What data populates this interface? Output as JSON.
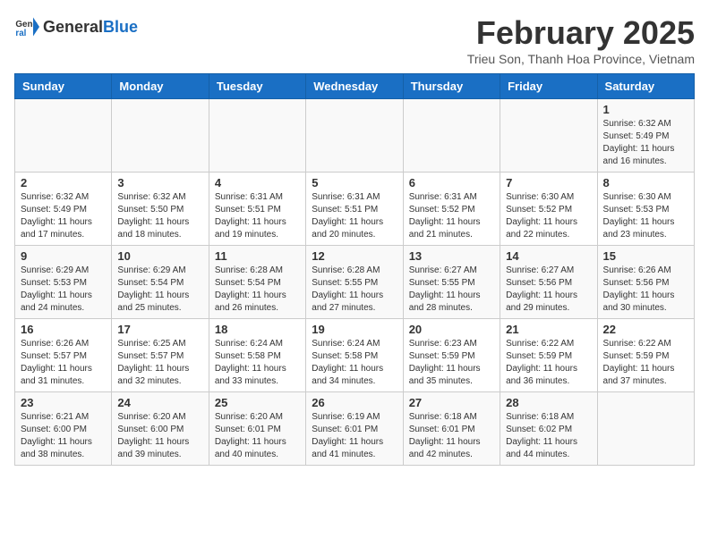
{
  "header": {
    "logo_general": "General",
    "logo_blue": "Blue",
    "main_title": "February 2025",
    "sub_title": "Trieu Son, Thanh Hoa Province, Vietnam"
  },
  "weekdays": [
    "Sunday",
    "Monday",
    "Tuesday",
    "Wednesday",
    "Thursday",
    "Friday",
    "Saturday"
  ],
  "weeks": [
    [
      {
        "day": "",
        "info": ""
      },
      {
        "day": "",
        "info": ""
      },
      {
        "day": "",
        "info": ""
      },
      {
        "day": "",
        "info": ""
      },
      {
        "day": "",
        "info": ""
      },
      {
        "day": "",
        "info": ""
      },
      {
        "day": "1",
        "info": "Sunrise: 6:32 AM\nSunset: 5:49 PM\nDaylight: 11 hours and 16 minutes."
      }
    ],
    [
      {
        "day": "2",
        "info": "Sunrise: 6:32 AM\nSunset: 5:49 PM\nDaylight: 11 hours and 17 minutes."
      },
      {
        "day": "3",
        "info": "Sunrise: 6:32 AM\nSunset: 5:50 PM\nDaylight: 11 hours and 18 minutes."
      },
      {
        "day": "4",
        "info": "Sunrise: 6:31 AM\nSunset: 5:51 PM\nDaylight: 11 hours and 19 minutes."
      },
      {
        "day": "5",
        "info": "Sunrise: 6:31 AM\nSunset: 5:51 PM\nDaylight: 11 hours and 20 minutes."
      },
      {
        "day": "6",
        "info": "Sunrise: 6:31 AM\nSunset: 5:52 PM\nDaylight: 11 hours and 21 minutes."
      },
      {
        "day": "7",
        "info": "Sunrise: 6:30 AM\nSunset: 5:52 PM\nDaylight: 11 hours and 22 minutes."
      },
      {
        "day": "8",
        "info": "Sunrise: 6:30 AM\nSunset: 5:53 PM\nDaylight: 11 hours and 23 minutes."
      }
    ],
    [
      {
        "day": "9",
        "info": "Sunrise: 6:29 AM\nSunset: 5:53 PM\nDaylight: 11 hours and 24 minutes."
      },
      {
        "day": "10",
        "info": "Sunrise: 6:29 AM\nSunset: 5:54 PM\nDaylight: 11 hours and 25 minutes."
      },
      {
        "day": "11",
        "info": "Sunrise: 6:28 AM\nSunset: 5:54 PM\nDaylight: 11 hours and 26 minutes."
      },
      {
        "day": "12",
        "info": "Sunrise: 6:28 AM\nSunset: 5:55 PM\nDaylight: 11 hours and 27 minutes."
      },
      {
        "day": "13",
        "info": "Sunrise: 6:27 AM\nSunset: 5:55 PM\nDaylight: 11 hours and 28 minutes."
      },
      {
        "day": "14",
        "info": "Sunrise: 6:27 AM\nSunset: 5:56 PM\nDaylight: 11 hours and 29 minutes."
      },
      {
        "day": "15",
        "info": "Sunrise: 6:26 AM\nSunset: 5:56 PM\nDaylight: 11 hours and 30 minutes."
      }
    ],
    [
      {
        "day": "16",
        "info": "Sunrise: 6:26 AM\nSunset: 5:57 PM\nDaylight: 11 hours and 31 minutes."
      },
      {
        "day": "17",
        "info": "Sunrise: 6:25 AM\nSunset: 5:57 PM\nDaylight: 11 hours and 32 minutes."
      },
      {
        "day": "18",
        "info": "Sunrise: 6:24 AM\nSunset: 5:58 PM\nDaylight: 11 hours and 33 minutes."
      },
      {
        "day": "19",
        "info": "Sunrise: 6:24 AM\nSunset: 5:58 PM\nDaylight: 11 hours and 34 minutes."
      },
      {
        "day": "20",
        "info": "Sunrise: 6:23 AM\nSunset: 5:59 PM\nDaylight: 11 hours and 35 minutes."
      },
      {
        "day": "21",
        "info": "Sunrise: 6:22 AM\nSunset: 5:59 PM\nDaylight: 11 hours and 36 minutes."
      },
      {
        "day": "22",
        "info": "Sunrise: 6:22 AM\nSunset: 5:59 PM\nDaylight: 11 hours and 37 minutes."
      }
    ],
    [
      {
        "day": "23",
        "info": "Sunrise: 6:21 AM\nSunset: 6:00 PM\nDaylight: 11 hours and 38 minutes."
      },
      {
        "day": "24",
        "info": "Sunrise: 6:20 AM\nSunset: 6:00 PM\nDaylight: 11 hours and 39 minutes."
      },
      {
        "day": "25",
        "info": "Sunrise: 6:20 AM\nSunset: 6:01 PM\nDaylight: 11 hours and 40 minutes."
      },
      {
        "day": "26",
        "info": "Sunrise: 6:19 AM\nSunset: 6:01 PM\nDaylight: 11 hours and 41 minutes."
      },
      {
        "day": "27",
        "info": "Sunrise: 6:18 AM\nSunset: 6:01 PM\nDaylight: 11 hours and 42 minutes."
      },
      {
        "day": "28",
        "info": "Sunrise: 6:18 AM\nSunset: 6:02 PM\nDaylight: 11 hours and 44 minutes."
      },
      {
        "day": "",
        "info": ""
      }
    ]
  ]
}
